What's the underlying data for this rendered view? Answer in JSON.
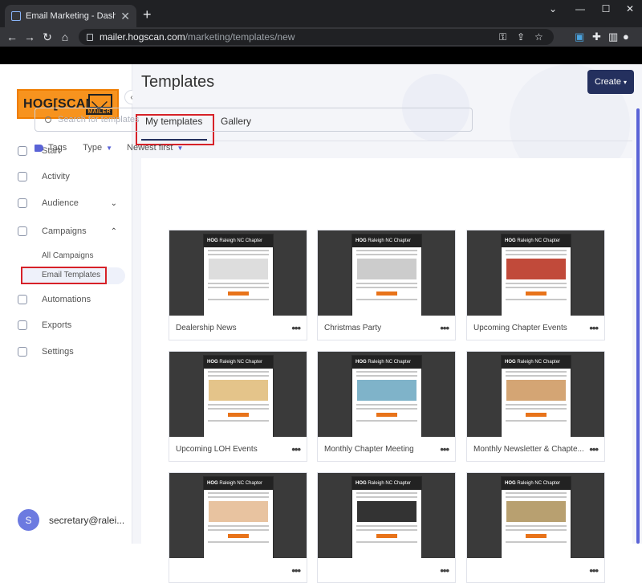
{
  "browser": {
    "tab_title": "Email Marketing - Dashboard",
    "url_host": "mailer.hogscan.com",
    "url_path": "/marketing/templates/new"
  },
  "sidebar": {
    "logo_text": "HOG[SCAN]",
    "logo_sub": "MAILER",
    "items": [
      {
        "label": "Start",
        "icon": "home-icon"
      },
      {
        "label": "Activity",
        "icon": "chart-line-icon"
      },
      {
        "label": "Audience",
        "icon": "users-icon"
      },
      {
        "label": "Campaigns",
        "icon": "paper-plane-icon"
      },
      {
        "label": "Automations",
        "icon": "rocket-icon"
      },
      {
        "label": "Exports",
        "icon": "download-icon"
      },
      {
        "label": "Settings",
        "icon": "gear-icon"
      }
    ],
    "campaigns_sub": [
      "All Campaigns",
      "Email Templates"
    ],
    "user": {
      "initial": "S",
      "name": "secretary@ralei..."
    }
  },
  "main": {
    "title": "Templates",
    "create_label": "Create",
    "tabs": [
      "My templates",
      "Gallery"
    ],
    "search_placeholder": "Search for templates",
    "filters": {
      "tags": "Tags",
      "type": "Type",
      "sort": "Newest first"
    },
    "templates": [
      {
        "name": "Dealership News"
      },
      {
        "name": "Christmas Party"
      },
      {
        "name": "Upcoming Chapter Events"
      },
      {
        "name": "Upcoming LOH Events"
      },
      {
        "name": "Monthly Chapter Meeting"
      },
      {
        "name": "Monthly Newsletter & Chapte..."
      },
      {
        "name": ""
      },
      {
        "name": ""
      },
      {
        "name": ""
      }
    ],
    "thumb_header": "Raleigh NC Chapter",
    "thumb_brand": "HOG"
  },
  "colors": {
    "accent": "#24305e",
    "highlight": "#d72128",
    "brand_orange": "#f7931e",
    "tag_blue": "#5a63d6"
  }
}
